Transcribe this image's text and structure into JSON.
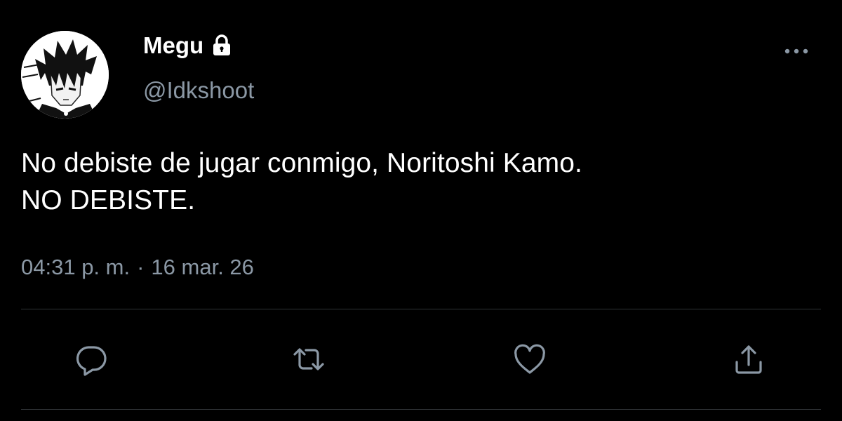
{
  "user": {
    "display_name": "Megu",
    "handle": "@Idkshoot",
    "protected": true,
    "avatar_icon": "avatar-anime-character"
  },
  "tweet": {
    "text": "No debiste de jugar conmigo, Noritoshi Kamo.\nNO DEBISTE.",
    "time": "04:31 p. m.",
    "separator": "·",
    "date": "16 mar. 26"
  },
  "icons": {
    "lock": "lock-icon",
    "more": "more-horizontal-icon",
    "reply": "reply-icon",
    "retweet": "retweet-icon",
    "like": "heart-icon",
    "share": "share-icon"
  },
  "colors": {
    "background": "#000000",
    "primary_text": "#ffffff",
    "secondary_text": "#8b98a5",
    "divider": "#2f3336"
  }
}
